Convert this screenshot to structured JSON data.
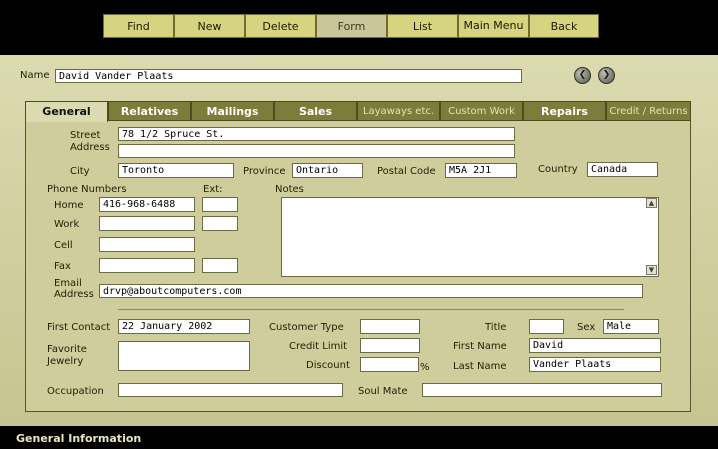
{
  "toolbar": {
    "buttons": [
      {
        "label": "Find"
      },
      {
        "label": "New"
      },
      {
        "label": "Delete"
      },
      {
        "label": "Form"
      },
      {
        "label": "List"
      },
      {
        "label": "Main Menu"
      },
      {
        "label": "Back"
      }
    ]
  },
  "record": {
    "name_label": "Name",
    "name_value": "David Vander Plaats",
    "prev_icon": "chevron-left-icon",
    "next_icon": "chevron-right-icon"
  },
  "tabs": [
    {
      "label": "General",
      "selected": true
    },
    {
      "label": "Relatives"
    },
    {
      "label": "Mailings"
    },
    {
      "label": "Sales"
    },
    {
      "label": "Layaways etc."
    },
    {
      "label": "Custom Work"
    },
    {
      "label": "Repairs"
    },
    {
      "label": "Credit / Returns"
    }
  ],
  "general": {
    "street_label": "Street",
    "address_label": "Address",
    "street_value": "78 1/2 Spruce St.",
    "street_value2": "",
    "city_label": "City",
    "city_value": "Toronto",
    "province_label": "Province",
    "province_value": "Ontario",
    "postal_label": "Postal Code",
    "postal_value": "M5A 2J1",
    "country_label": "Country",
    "country_value": "Canada",
    "phone_header": "Phone Numbers",
    "ext_header": "Ext:",
    "notes_label": "Notes",
    "home_label": "Home",
    "home_value": "416-968-6488",
    "work_label": "Work",
    "cell_label": "Cell",
    "fax_label": "Fax",
    "email_label_1": "Email",
    "email_label_2": "Address",
    "email_value": "drvp@aboutcomputers.com",
    "first_contact_label": "First Contact",
    "first_contact_value": "22 January 2002",
    "customer_type_label": "Customer Type",
    "title_label": "Title",
    "sex_label": "Sex",
    "sex_value": "Male",
    "fav_jewelry_label_1": "Favorite",
    "fav_jewelry_label_2": "Jewelry",
    "credit_limit_label": "Credit Limit",
    "first_name_label": "First Name",
    "first_name_value": "David",
    "discount_label": "Discount",
    "percent_sign": "%",
    "last_name_label": "Last Name",
    "last_name_value": "Vander Plaats",
    "occupation_label": "Occupation",
    "soul_mate_label": "Soul Mate"
  },
  "status": {
    "text": "General Information"
  },
  "colors": {
    "toolbar_button": "#d6d47e",
    "tab": "#7e7c3a",
    "panel": "#cfcd9b",
    "band": "#dcdab0"
  }
}
